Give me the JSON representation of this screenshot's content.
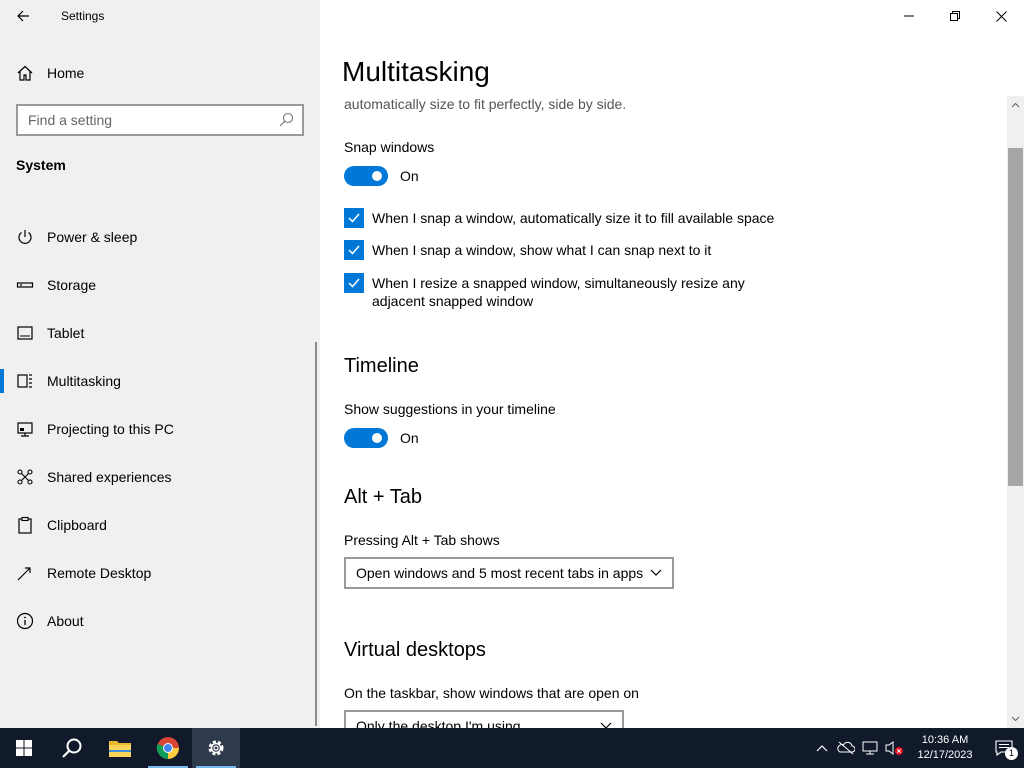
{
  "window": {
    "title": "Settings"
  },
  "sidebar": {
    "home_label": "Home",
    "search": {
      "placeholder": "Find a setting"
    },
    "section_title": "System",
    "items": [
      {
        "label": "Power & sleep",
        "icon": "power-icon",
        "active": false
      },
      {
        "label": "Storage",
        "icon": "storage-icon",
        "active": false
      },
      {
        "label": "Tablet",
        "icon": "tablet-icon",
        "active": false
      },
      {
        "label": "Multitasking",
        "icon": "multitasking-icon",
        "active": true
      },
      {
        "label": "Projecting to this PC",
        "icon": "projecting-icon",
        "active": false
      },
      {
        "label": "Shared experiences",
        "icon": "shared-experiences-icon",
        "active": false
      },
      {
        "label": "Clipboard",
        "icon": "clipboard-icon",
        "active": false
      },
      {
        "label": "Remote Desktop",
        "icon": "remote-desktop-icon",
        "active": false
      },
      {
        "label": "About",
        "icon": "info-icon",
        "active": false
      }
    ]
  },
  "main": {
    "page_title": "Multitasking",
    "snap_description": "automatically size to fit perfectly, side by side.",
    "snap": {
      "label": "Snap windows",
      "toggle_state": "On",
      "options": [
        {
          "label": "When I snap a window, automatically size it to fill available space",
          "checked": true
        },
        {
          "label": "When I snap a window, show what I can snap next to it",
          "checked": true
        },
        {
          "label": "When I resize a snapped window, simultaneously resize any adjacent snapped window",
          "checked": true
        }
      ]
    },
    "timeline": {
      "heading": "Timeline",
      "label": "Show suggestions in your timeline",
      "toggle_state": "On"
    },
    "alt_tab": {
      "heading": "Alt + Tab",
      "label": "Pressing Alt + Tab shows",
      "selected": "Open windows and 5 most recent tabs in apps"
    },
    "virtual_desktops": {
      "heading": "Virtual desktops",
      "label": "On the taskbar, show windows that are open on",
      "selected": "Only the desktop I'm using"
    }
  },
  "taskbar": {
    "apps": [
      "start-icon",
      "search-icon",
      "file-explorer-icon",
      "chrome-icon",
      "settings-icon"
    ],
    "clock": {
      "time": "10:36 AM",
      "date": "12/17/2023"
    },
    "notification_count": "1"
  },
  "colors": {
    "accent": "#0078d7",
    "sidebar_bg": "#f0f0f0",
    "taskbar_bg": "#101a2b"
  }
}
